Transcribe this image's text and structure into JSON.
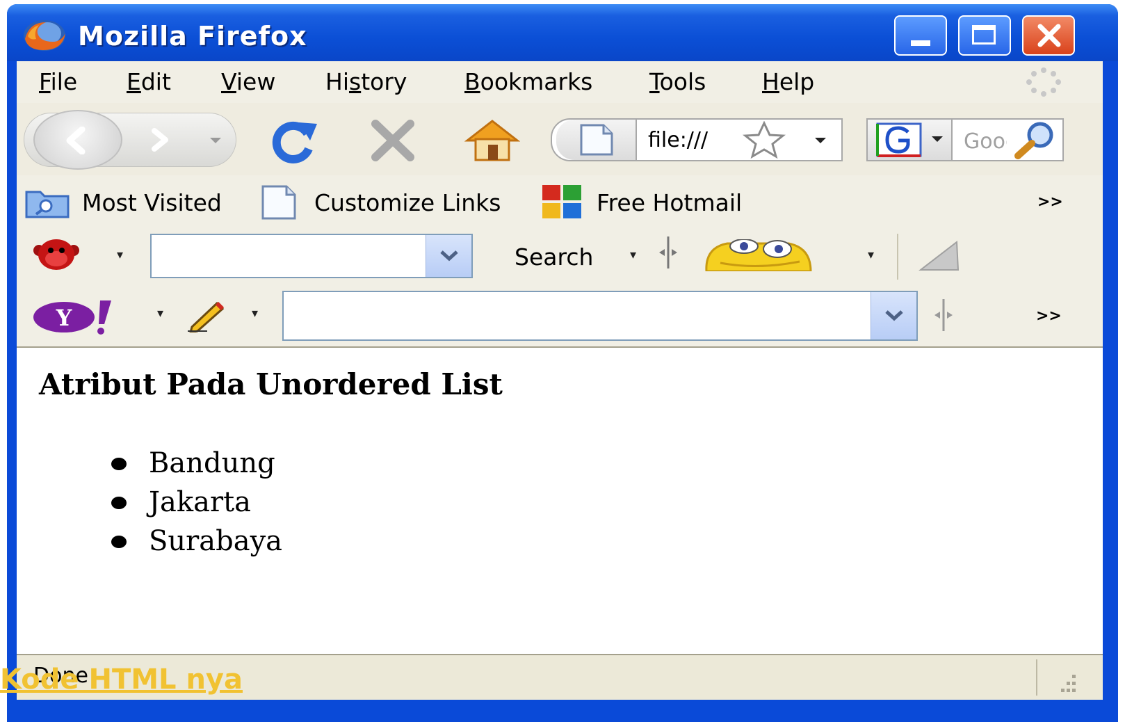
{
  "window": {
    "title": "Mozilla Firefox"
  },
  "menu": {
    "items": [
      "File",
      "Edit",
      "View",
      "History",
      "Bookmarks",
      "Tools",
      "Help"
    ],
    "mnemonics": [
      "F",
      "E",
      "V",
      "s",
      "B",
      "T",
      "H"
    ]
  },
  "navigation": {
    "url": "file:///",
    "search_placeholder": "Google",
    "icons": [
      "back-icon",
      "forward-icon",
      "reload-icon",
      "stop-icon",
      "home-icon",
      "page-icon",
      "star-icon",
      "google-icon",
      "magnifier-icon"
    ]
  },
  "bookmarks": {
    "items": [
      {
        "label": "Most Visited",
        "icon": "folder-search-icon"
      },
      {
        "label": "Customize Links",
        "icon": "page-icon"
      },
      {
        "label": "Free Hotmail",
        "icon": "windows-live-icon"
      }
    ],
    "overflow": ">>"
  },
  "toolbar3": {
    "search_label": "Search"
  },
  "toolbar4": {
    "overflow": ">>"
  },
  "page": {
    "heading": "Atribut Pada Unordered List",
    "list": [
      "Bandung",
      "Jakarta",
      "Surabaya"
    ]
  },
  "status": {
    "text": "Done"
  },
  "overlay": {
    "caption": "Kode HTML nya"
  },
  "colors": {
    "titlebar": "#0b4fd6",
    "chrome": "#ece9d8",
    "caption": "#f1c232"
  }
}
